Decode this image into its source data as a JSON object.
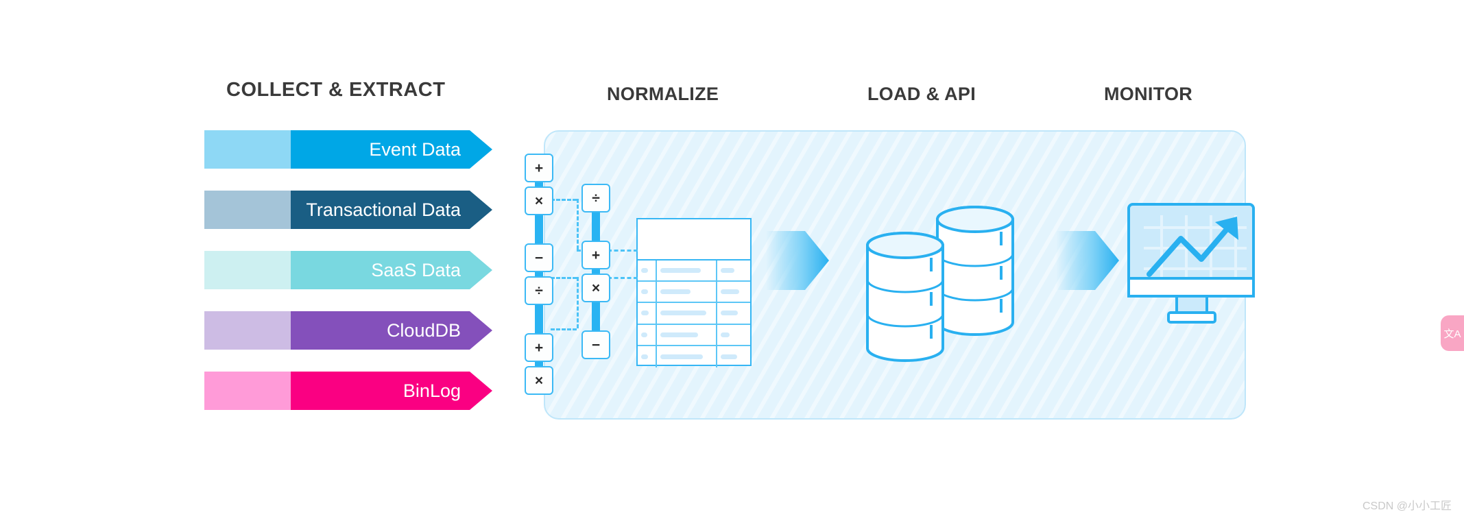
{
  "stages": {
    "collect": "COLLECT & EXTRACT",
    "normalize": "NORMALIZE",
    "load": "LOAD & API",
    "monitor": "MONITOR"
  },
  "sources": [
    {
      "label": "Event Data",
      "light": "#8ed8f5",
      "dark": "#00a7e6"
    },
    {
      "label": "Transactional  Data",
      "light": "#a4c4d8",
      "dark": "#1a5e84"
    },
    {
      "label": "SaaS Data",
      "light": "#cdf0f1",
      "dark": "#79d8e0"
    },
    {
      "label": "CloudDB",
      "light": "#cdbce4",
      "dark": "#8450bb"
    },
    {
      "label": "BinLog",
      "light": "#ff9bd8",
      "dark": "#fa0082"
    }
  ],
  "operators": {
    "column_a": [
      "+",
      "×",
      "−",
      "÷",
      "+",
      "×"
    ],
    "column_b": [
      "÷",
      "+",
      "×",
      "−"
    ]
  },
  "table": {
    "header": "",
    "rows": [
      {
        "c1": "",
        "c2": "",
        "c3": ""
      },
      {
        "c1": "",
        "c2": "",
        "c3": ""
      },
      {
        "c1": "",
        "c2": "",
        "c3": ""
      },
      {
        "c1": "",
        "c2": "",
        "c3": ""
      },
      {
        "c1": "",
        "c2": "",
        "c3": ""
      }
    ]
  },
  "icons": {
    "database": "database-stack-icon",
    "monitor": "monitor-chart-icon",
    "chevron": "chevron-arrow-icon",
    "translate": "translate-icon"
  },
  "translate_fab": {
    "label": "文A"
  },
  "watermark": "CSDN @小小工匠",
  "colors": {
    "panel_bg": "#e3f4fd",
    "panel_border": "#bfe6fa",
    "accent": "#29b3f2",
    "accent_dark": "#0d9fe0",
    "title": "#3a3a3a"
  }
}
